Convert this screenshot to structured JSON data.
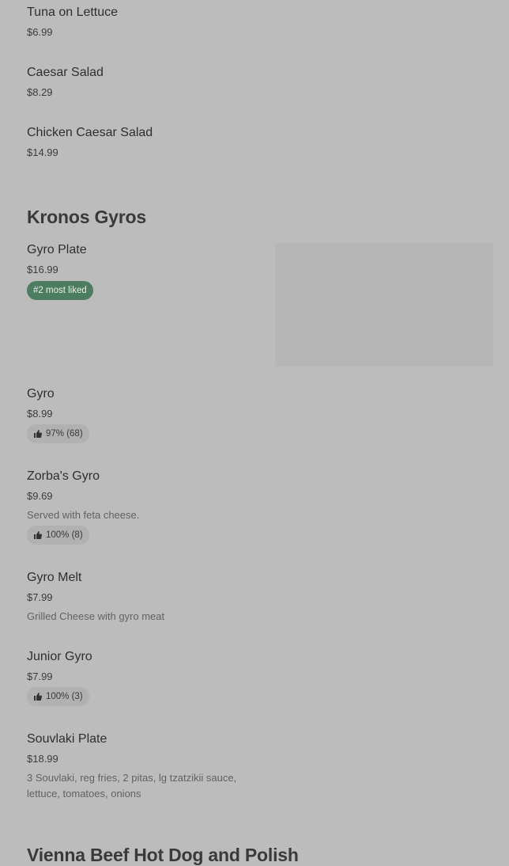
{
  "items_top": [
    {
      "name": "Tuna on Lettuce",
      "price": "$6.99"
    },
    {
      "name": "Caesar Salad",
      "price": "$8.29"
    },
    {
      "name": "Chicken Caesar Salad",
      "price": "$14.99"
    }
  ],
  "sections": [
    {
      "title": "Kronos Gyros"
    },
    {
      "title": "Vienna Beef Hot Dog and Polish"
    }
  ],
  "gyros": {
    "gyro_plate": {
      "name": "Gyro Plate",
      "price": "$16.99",
      "badge": "#2 most liked"
    },
    "gyro": {
      "name": "Gyro",
      "price": "$8.99",
      "rating": "97% (68)"
    },
    "zorbas": {
      "name": "Zorba's Gyro",
      "price": "$9.69",
      "desc": "Served with feta cheese.",
      "rating": "100% (8)"
    },
    "gyro_melt": {
      "name": "Gyro Melt",
      "price": "$7.99",
      "desc": "Grilled Cheese with gyro meat"
    },
    "junior": {
      "name": "Junior Gyro",
      "price": "$7.99",
      "rating": "100% (3)"
    },
    "souvlaki": {
      "name": "Souvlaki Plate",
      "price": "$18.99",
      "desc": "3 Souvlaki, reg fries, 2 pitas, lg tzatzikii sauce, lettuce, tomatoes, onions"
    }
  },
  "icons": {
    "thumbs_up": "thumbs-up-icon"
  },
  "colors": {
    "background": "#bcbcbc",
    "badge_green": "#4d7d61",
    "pill_bg": "#b1b1b1"
  }
}
